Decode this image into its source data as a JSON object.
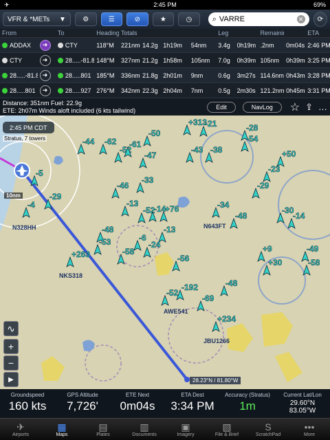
{
  "status_bar": {
    "carrier": "✈",
    "wifi": "︎◠",
    "time": "2:45 PM",
    "battery": "69%"
  },
  "toolbar": {
    "layer_label": "VFR & *METs",
    "search_value": "VARRE"
  },
  "flight_plan": {
    "headers": [
      "From",
      "To",
      "Heading",
      "Totals",
      "",
      "",
      "Leg",
      "",
      "",
      "",
      "Remaining",
      "",
      "ETA"
    ],
    "rows": [
      {
        "from": "ADDAX",
        "to": "CTY",
        "heading": "118°M",
        "t_dist": "221nm",
        "t_fuel": "14.2g",
        "t_time": "1h19m",
        "l_dist": "54nm",
        "l_fuel": "3.4g",
        "l_time": "0h19m",
        "r_dist": ".2nm",
        "r_time": "0m04s",
        "eta": "2:46 PM"
      },
      {
        "from": "CTY",
        "to": "28.....-81.8",
        "heading": "148°M",
        "t_dist": "327nm",
        "t_fuel": "21.2g",
        "t_time": "1h58m",
        "l_dist": "105nm",
        "l_fuel": "7.0g",
        "l_time": "0h39m",
        "r_dist": "105nm",
        "r_time": "0h39m",
        "eta": "3:25 PM"
      },
      {
        "from": "28.....-81.8",
        "to": "28.....801",
        "heading": "185°M",
        "t_dist": "336nm",
        "t_fuel": "21.8g",
        "t_time": "2h01m",
        "l_dist": "9nm",
        "l_fuel": "0.6g",
        "l_time": "3m27s",
        "r_dist": "114.6nm",
        "r_time": "0h43m",
        "eta": "3:28 PM"
      },
      {
        "from": "28.....801",
        "to": "28.....927",
        "heading": "276°M",
        "t_dist": "342nm",
        "t_fuel": "22.3g",
        "t_time": "2h04m",
        "l_dist": "7nm",
        "l_fuel": "0.5g",
        "l_time": "2m30s",
        "r_dist": "121.2nm",
        "r_time": "0h45m",
        "eta": "3:31 PM"
      }
    ],
    "summary_line1": "Distance: 351nm  Fuel: 22.9g",
    "summary_line2": "ETE: 2h07m  Winds aloft included (6 kts tailwind)",
    "edit_label": "Edit",
    "navlog_label": "NavLog"
  },
  "map": {
    "time_label": "2:45 PM CDT",
    "status_label": "Stratus, 7 towers",
    "scale_label": "10nm",
    "coord_label": "28.23°N / 81.80°W",
    "tags": [
      {
        "id": "N328HH",
        "text": "N328HH"
      },
      {
        "id": "NKS318",
        "text": "NKS318"
      },
      {
        "id": "N643FT",
        "text": "N643FT"
      },
      {
        "id": "JBU1266",
        "text": "JBU1266"
      },
      {
        "id": "AWE541",
        "text": "AWE541"
      }
    ],
    "traffic": [
      "-44",
      "-62",
      "-52",
      "-61",
      "-50",
      "-47",
      "-33",
      "-46",
      "-13",
      "-52",
      "-14",
      "+76",
      "-13",
      "-48",
      "-53",
      "-6",
      "-24",
      "-58",
      "+263",
      "-56",
      "-52",
      "-192",
      "-69",
      "-48",
      "+234",
      "+313",
      "-21",
      "-43",
      "-38",
      "-28",
      "-54",
      "-34",
      "-48",
      "-23",
      "-29",
      "-30",
      "-14",
      "+9",
      "+30",
      "-49",
      "-58",
      "-4",
      "-29",
      "-5",
      "+50"
    ]
  },
  "instruments": [
    {
      "label": "Groundspeed",
      "value": "160 kts"
    },
    {
      "label": "GPS Altitude",
      "value": "7,726'"
    },
    {
      "label": "ETE Next",
      "value": "0m04s"
    },
    {
      "label": "ETA Dest",
      "value": "3:34 PM"
    },
    {
      "label": "Accuracy (Stratus)",
      "value": "1m"
    },
    {
      "label": "Current Lat/Lon",
      "value": "29.60°N",
      "value2": "83.05°W"
    }
  ],
  "tabs": [
    "Airports",
    "Maps",
    "Plates",
    "Documents",
    "Imagery",
    "File & Brief",
    "ScratchPad",
    "More"
  ],
  "colors": {
    "accent": "#3f7fe0",
    "route": "#3a57d8",
    "traffic": "#33d3c8",
    "green": "#5bf05b"
  }
}
